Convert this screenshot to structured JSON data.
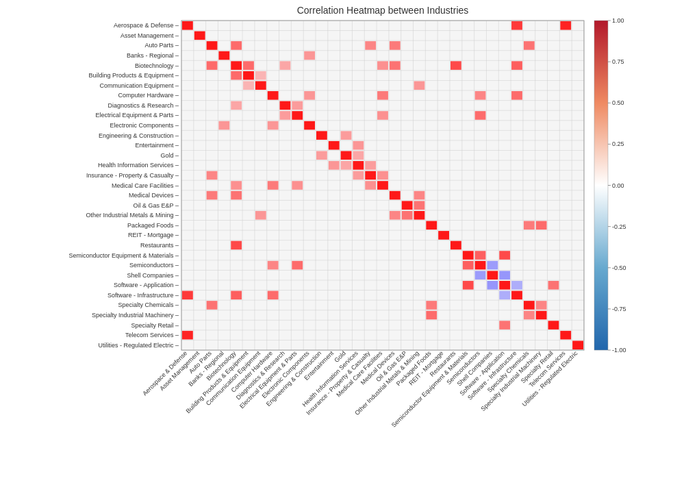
{
  "title": "Correlation Heatmap between Industries",
  "industries": [
    "Aerospace & Defense",
    "Asset Management",
    "Auto Parts",
    "Banks - Regional",
    "Biotechnology",
    "Building Products & Equipment",
    "Communication Equipment",
    "Computer Hardware",
    "Diagnostics & Research",
    "Electrical Equipment & Parts",
    "Electronic Components",
    "Engineering & Construction",
    "Entertainment",
    "Gold",
    "Health Information Services",
    "Insurance - Property & Casualty",
    "Medical Care Facilities",
    "Medical Devices",
    "Oil & Gas E&P",
    "Other Industrial Metals & Mining",
    "Packaged Foods",
    "REIT - Mortgage",
    "Restaurants",
    "Semiconductor Equipment & Materials",
    "Semiconductors",
    "Shell Companies",
    "Software - Application",
    "Software - Infrastructure",
    "Specialty Chemicals",
    "Specialty Industrial Machinery",
    "Specialty Retail",
    "Telecom Services",
    "Utilities - Regulated Electric"
  ],
  "colorbar": {
    "min": -1.0,
    "max": 1.0,
    "ticks": [
      1.0,
      0.75,
      0.5,
      0.25,
      0.0,
      -0.25,
      -0.5,
      -0.75,
      -1.0
    ]
  },
  "correlations": [
    {
      "row": 0,
      "col": 27,
      "val": 0.85
    },
    {
      "row": 0,
      "col": 31,
      "val": 0.95
    },
    {
      "row": 2,
      "col": 4,
      "val": 0.72
    },
    {
      "row": 2,
      "col": 15,
      "val": 0.65
    },
    {
      "row": 2,
      "col": 17,
      "val": 0.68
    },
    {
      "row": 2,
      "col": 28,
      "val": 0.7
    },
    {
      "row": 3,
      "col": 10,
      "val": 0.6
    },
    {
      "row": 4,
      "col": 5,
      "val": 0.78
    },
    {
      "row": 4,
      "col": 8,
      "val": 0.55
    },
    {
      "row": 4,
      "col": 16,
      "val": 0.62
    },
    {
      "row": 4,
      "col": 17,
      "val": 0.7
    },
    {
      "row": 4,
      "col": 22,
      "val": 0.8
    },
    {
      "row": 4,
      "col": 27,
      "val": 0.75
    },
    {
      "row": 5,
      "col": 4,
      "val": 0.72
    },
    {
      "row": 5,
      "col": 6,
      "val": 0.5
    },
    {
      "row": 6,
      "col": 19,
      "val": 0.6
    },
    {
      "row": 7,
      "col": 10,
      "val": 0.62
    },
    {
      "row": 7,
      "col": 16,
      "val": 0.68
    },
    {
      "row": 7,
      "col": 24,
      "val": 0.65
    },
    {
      "row": 7,
      "col": 27,
      "val": 0.72
    },
    {
      "row": 8,
      "col": 9,
      "val": 0.55
    },
    {
      "row": 9,
      "col": 8,
      "val": 0.58
    },
    {
      "row": 9,
      "col": 16,
      "val": 0.62
    },
    {
      "row": 9,
      "col": 24,
      "val": 0.72
    },
    {
      "row": 10,
      "col": 7,
      "val": 0.6
    },
    {
      "row": 11,
      "col": 13,
      "val": 0.58
    },
    {
      "row": 12,
      "col": 14,
      "val": 0.62
    },
    {
      "row": 13,
      "col": 14,
      "val": 0.55
    },
    {
      "row": 14,
      "col": 12,
      "val": 0.6
    },
    {
      "row": 15,
      "col": 14,
      "val": 0.58
    },
    {
      "row": 16,
      "col": 15,
      "val": 0.62
    },
    {
      "row": 17,
      "col": 19,
      "val": 0.6
    },
    {
      "row": 18,
      "col": 19,
      "val": 0.72
    },
    {
      "row": 19,
      "col": 17,
      "val": 0.65
    },
    {
      "row": 19,
      "col": 18,
      "val": 0.7
    },
    {
      "row": 20,
      "col": 28,
      "val": 0.68
    },
    {
      "row": 20,
      "col": 29,
      "val": 0.72
    },
    {
      "row": 23,
      "col": 24,
      "val": 0.75
    },
    {
      "row": 23,
      "col": 26,
      "val": 0.78
    },
    {
      "row": 24,
      "col": 23,
      "val": 0.75
    },
    {
      "row": 24,
      "col": 25,
      "val": -0.55
    },
    {
      "row": 25,
      "col": 24,
      "val": -0.58
    },
    {
      "row": 25,
      "col": 26,
      "val": -0.62
    },
    {
      "row": 26,
      "col": 23,
      "val": 0.8
    },
    {
      "row": 26,
      "col": 25,
      "val": -0.6
    },
    {
      "row": 26,
      "col": 27,
      "val": -0.5
    },
    {
      "row": 27,
      "col": 26,
      "val": -0.52
    },
    {
      "row": 28,
      "col": 29,
      "val": 0.65
    },
    {
      "row": 29,
      "col": 28,
      "val": 0.65
    },
    {
      "row": 30,
      "col": 26,
      "val": 0.7
    }
  ]
}
